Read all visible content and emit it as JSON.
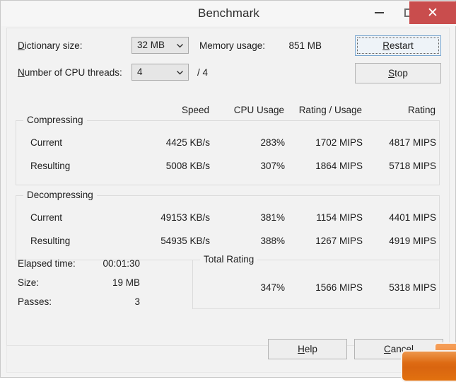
{
  "window": {
    "title": "Benchmark",
    "controls": {
      "minimize": "—",
      "maximize": "□",
      "close": "✕"
    },
    "close_color": "#c94d4d"
  },
  "settings": {
    "dictionary_label_pre": "D",
    "dictionary_label_post": "ictionary size:",
    "dictionary_value": "32 MB",
    "threads_label_pre": "N",
    "threads_label_post": "umber of CPU threads:",
    "threads_value": "4",
    "threads_max": "/ 4",
    "memory_label": "Memory usage:",
    "memory_value": "851 MB"
  },
  "actions": {
    "restart_pre": "R",
    "restart_post": "estart",
    "stop_pre": "S",
    "stop_post": "top",
    "help_pre": "H",
    "help_post": "elp",
    "cancel_pre": "C",
    "cancel_post": "ancel"
  },
  "columns": {
    "speed": "Speed",
    "cpu_usage": "CPU Usage",
    "rating_usage": "Rating / Usage",
    "rating": "Rating"
  },
  "compressing": {
    "title": "Compressing",
    "rows": [
      {
        "label": "Current",
        "speed": "4425 KB/s",
        "cpu_usage": "283%",
        "rating_usage": "1702 MIPS",
        "rating": "4817 MIPS"
      },
      {
        "label": "Resulting",
        "speed": "5008 KB/s",
        "cpu_usage": "307%",
        "rating_usage": "1864 MIPS",
        "rating": "5718 MIPS"
      }
    ]
  },
  "decompressing": {
    "title": "Decompressing",
    "rows": [
      {
        "label": "Current",
        "speed": "49153 KB/s",
        "cpu_usage": "381%",
        "rating_usage": "1154 MIPS",
        "rating": "4401 MIPS"
      },
      {
        "label": "Resulting",
        "speed": "54935 KB/s",
        "cpu_usage": "388%",
        "rating_usage": "1267 MIPS",
        "rating": "4919 MIPS"
      }
    ]
  },
  "stats": {
    "elapsed_label": "Elapsed time:",
    "elapsed_value": "00:01:30",
    "size_label": "Size:",
    "size_value": "19 MB",
    "passes_label": "Passes:",
    "passes_value": "3"
  },
  "total_rating": {
    "title": "Total Rating",
    "cpu_usage": "347%",
    "rating_usage": "1566 MIPS",
    "rating": "5318 MIPS"
  }
}
